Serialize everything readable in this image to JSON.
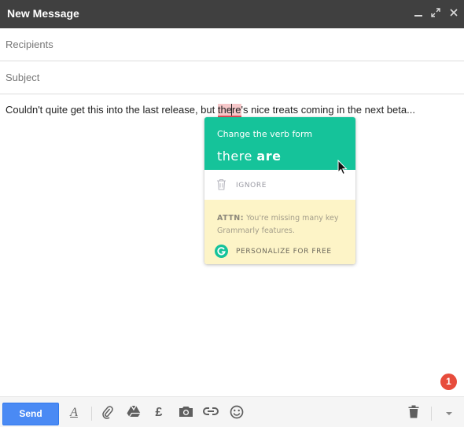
{
  "window": {
    "title": "New Message",
    "controls": [
      "minimize-icon",
      "expand-icon",
      "close-icon"
    ]
  },
  "fields": {
    "recipients_placeholder": "Recipients",
    "subject_placeholder": "Subject"
  },
  "message": {
    "before": "Couldn't quite get this into the last release, but ",
    "flag_a": "the",
    "flag_b": "re",
    "after": "'s nice treats coming in the next beta..."
  },
  "grammarly": {
    "subtitle": "Change the verb form",
    "suggestion_prefix": "there ",
    "suggestion_word": "are",
    "ignore_label": "IGNORE",
    "attn_title": "ATTN:",
    "attn_text": " You're missing many key Grammarly features.",
    "cta_label": "PERSONALIZE FOR FREE",
    "logo_letter": "G",
    "accent_color": "#15c39a"
  },
  "badge": {
    "count": "1",
    "color": "#e74c3c"
  },
  "toolbar": {
    "send_label": "Send",
    "formatting_glyph": "A",
    "currency_glyph": "£",
    "icons": [
      "formatting-icon",
      "attach-icon",
      "drive-icon",
      "money-icon",
      "photo-icon",
      "link-icon",
      "emoji-icon",
      "delete-icon",
      "more-options-icon"
    ]
  }
}
